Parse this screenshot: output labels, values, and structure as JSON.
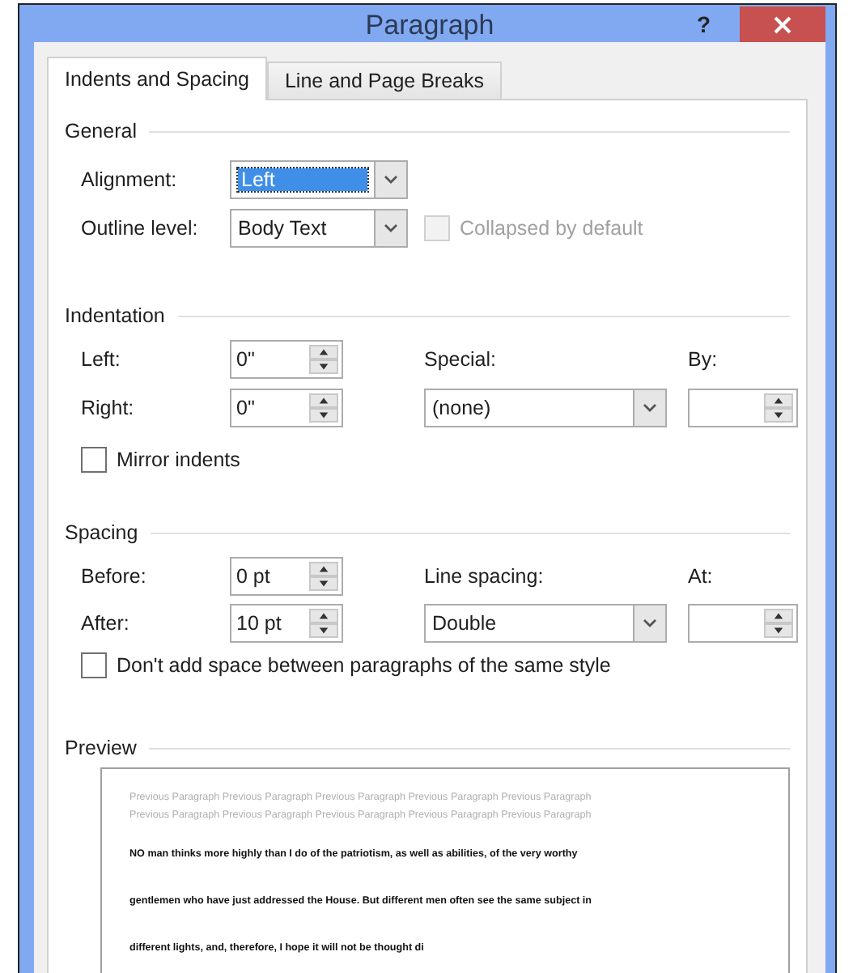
{
  "window": {
    "title": "Paragraph",
    "help": "?"
  },
  "tabs": [
    {
      "label": "Indents and Spacing",
      "selected": true
    },
    {
      "label": "Line and Page Breaks",
      "selected": false
    }
  ],
  "general": {
    "heading": "General",
    "alignment": {
      "label": "Alignment:",
      "value": "Left",
      "highlighted": true
    },
    "outline_level": {
      "label": "Outline level:",
      "value": "Body Text",
      "highlighted": false
    },
    "collapsed": {
      "label": "Collapsed by default",
      "checked": false,
      "disabled": true
    }
  },
  "indentation": {
    "heading": "Indentation",
    "left": {
      "label": "Left:",
      "value": "0\""
    },
    "right": {
      "label": "Right:",
      "value": "0\""
    },
    "special": {
      "label": "Special:",
      "value": "(none)",
      "highlighted": false
    },
    "by": {
      "label": "By:"
    },
    "mirror": {
      "label": "Mirror indents",
      "checked": false,
      "disabled": false
    }
  },
  "spacing": {
    "heading": "Spacing",
    "before": {
      "label": "Before:",
      "value": "0 pt"
    },
    "after": {
      "label": "After:",
      "value": "10 pt"
    },
    "line_spacing": {
      "label": "Line spacing:",
      "value": "Double",
      "highlighted": false
    },
    "at": {
      "label": "At:"
    },
    "dont_add": {
      "label": "Don't add space between paragraphs of the same style",
      "checked": false,
      "disabled": false
    }
  },
  "preview": {
    "heading": "Preview",
    "previous_lines": [
      "Previous Paragraph Previous Paragraph Previous Paragraph Previous Paragraph Previous Paragraph",
      "Previous Paragraph Previous Paragraph Previous Paragraph Previous Paragraph Previous Paragraph"
    ],
    "sample_lines": [
      "NO man thinks more highly than I do of the patriotism, as well as abilities, of the very worthy",
      "gentlemen who have just addressed the House. But different men often see the same subject in",
      "different lights, and, therefore, I hope it will not be thought di"
    ]
  }
}
